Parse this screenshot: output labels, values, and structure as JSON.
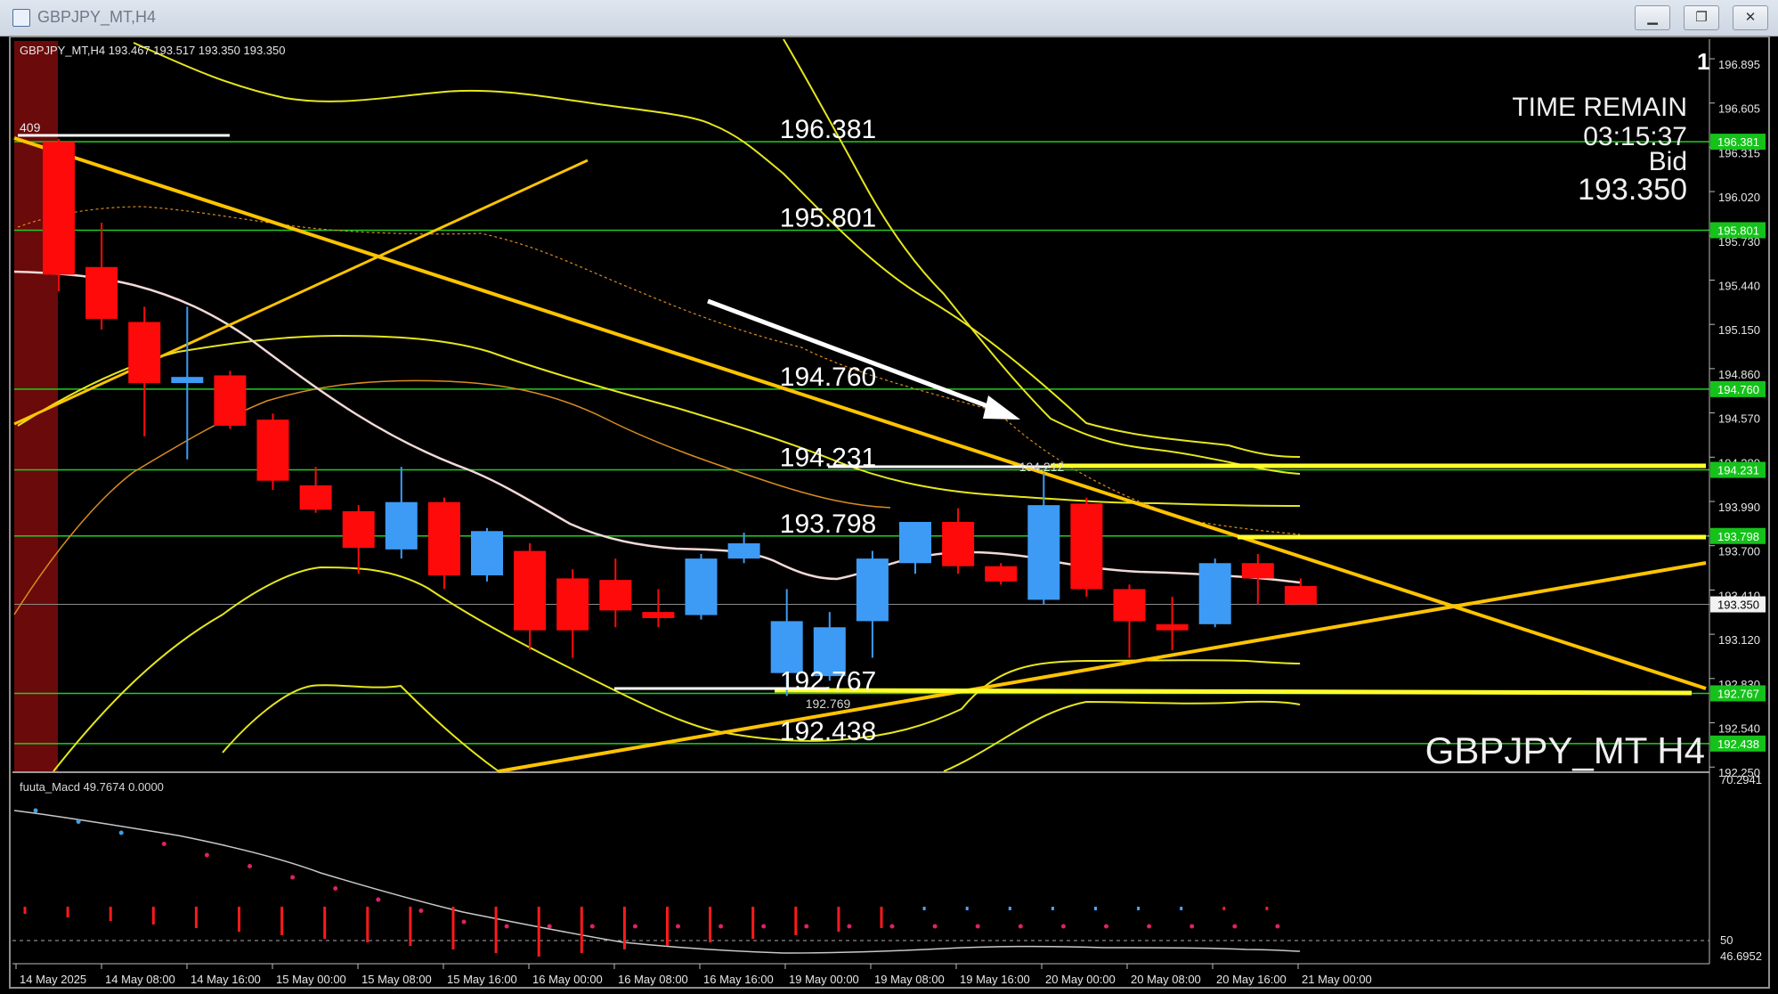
{
  "window": {
    "title": "GBPJPY_MT,H4",
    "minimize": "▁",
    "restore": "❐",
    "close": "✕"
  },
  "chart": {
    "header": "GBPJPY_MT,H4  193.467 193.517 193.350 193.350",
    "watermark": "GBPJPY_MT H4",
    "left_label": "409",
    "corner_mark": "1",
    "info": {
      "time_label": "TIME REMAIN",
      "time_value": "03:15:37",
      "bid_label": "Bid",
      "bid_value": "193.350"
    },
    "level_labels": [
      {
        "text": "196.381",
        "price": 196.381
      },
      {
        "text": "195.801",
        "price": 195.801
      },
      {
        "text": "194.760",
        "price": 194.76
      },
      {
        "text": "194.231",
        "price": 194.231
      },
      {
        "text": "193.798",
        "price": 193.798
      },
      {
        "text": "192.767",
        "price": 192.767
      },
      {
        "text": "192.438",
        "price": 192.438
      }
    ],
    "small_labels": [
      {
        "text": "194.212",
        "price": 194.212
      },
      {
        "text": "192.769",
        "price": 192.769
      }
    ],
    "colors": {
      "bull": "#3d9bf5",
      "bear": "#ff0a0a",
      "level": "#22cc22",
      "trend": "#ffc400",
      "band": "#e6e61e"
    }
  },
  "price_axis": {
    "ticks": [
      "196.895",
      "196.605",
      "196.315",
      "196.020",
      "195.730",
      "195.440",
      "195.150",
      "194.860",
      "194.570",
      "194.280",
      "193.990",
      "193.700",
      "193.410",
      "193.120",
      "192.830",
      "192.540",
      "192.250"
    ],
    "tags": [
      {
        "text": "196.381",
        "kind": "green"
      },
      {
        "text": "195.801",
        "kind": "green"
      },
      {
        "text": "194.760",
        "kind": "green"
      },
      {
        "text": "194.231",
        "kind": "green"
      },
      {
        "text": "193.798",
        "kind": "green"
      },
      {
        "text": "193.350",
        "kind": "white"
      },
      {
        "text": "192.767",
        "kind": "green"
      },
      {
        "text": "192.438",
        "kind": "green"
      }
    ]
  },
  "indicator": {
    "header": "fuuta_Macd 49.7674 0.0000",
    "ticks": [
      "70.2941",
      "50",
      "46.6952"
    ]
  },
  "time_axis": [
    "14 May 2025",
    "14 May 08:00",
    "14 May 16:00",
    "15 May 00:00",
    "15 May 08:00",
    "15 May 16:00",
    "16 May 00:00",
    "16 May 08:00",
    "16 May 16:00",
    "19 May 00:00",
    "19 May 08:00",
    "19 May 16:00",
    "20 May 00:00",
    "20 May 08:00",
    "20 May 16:00",
    "21 May 00:00"
  ],
  "chart_data": {
    "type": "candlestick",
    "symbol": "GBPJPY_MT",
    "timeframe": "H4",
    "candles": [
      {
        "o": 196.38,
        "h": 196.4,
        "c": 195.51,
        "l": 195.4
      },
      {
        "o": 195.56,
        "h": 195.85,
        "c": 195.22,
        "l": 195.15
      },
      {
        "o": 195.2,
        "h": 195.3,
        "c": 194.8,
        "l": 194.45
      },
      {
        "o": 194.8,
        "h": 195.3,
        "c": 194.84,
        "l": 194.3
      },
      {
        "o": 194.85,
        "h": 194.88,
        "c": 194.52,
        "l": 194.5
      },
      {
        "o": 194.56,
        "h": 194.6,
        "c": 194.16,
        "l": 194.1
      },
      {
        "o": 194.13,
        "h": 194.25,
        "c": 193.97,
        "l": 193.95
      },
      {
        "o": 193.96,
        "h": 194.0,
        "c": 193.72,
        "l": 193.55
      },
      {
        "o": 193.71,
        "h": 194.25,
        "c": 194.02,
        "l": 193.65
      },
      {
        "o": 194.02,
        "h": 194.05,
        "c": 193.54,
        "l": 193.45
      },
      {
        "o": 193.54,
        "h": 193.85,
        "c": 193.83,
        "l": 193.5
      },
      {
        "o": 193.7,
        "h": 193.75,
        "c": 193.18,
        "l": 193.05
      },
      {
        "o": 193.52,
        "h": 193.58,
        "c": 193.18,
        "l": 193.0
      },
      {
        "o": 193.51,
        "h": 193.65,
        "c": 193.31,
        "l": 193.2
      },
      {
        "o": 193.3,
        "h": 193.45,
        "c": 193.26,
        "l": 193.2
      },
      {
        "o": 193.28,
        "h": 193.68,
        "c": 193.65,
        "l": 193.25
      },
      {
        "o": 193.65,
        "h": 193.82,
        "c": 193.75,
        "l": 193.62
      },
      {
        "o": 192.9,
        "h": 193.45,
        "c": 193.24,
        "l": 192.75
      },
      {
        "o": 192.88,
        "h": 193.3,
        "c": 193.2,
        "l": 192.85
      },
      {
        "o": 193.24,
        "h": 193.7,
        "c": 193.65,
        "l": 193.0
      },
      {
        "o": 193.62,
        "h": 193.88,
        "c": 193.89,
        "l": 193.55
      },
      {
        "o": 193.89,
        "h": 193.98,
        "c": 193.6,
        "l": 193.55
      },
      {
        "o": 193.6,
        "h": 193.62,
        "c": 193.5,
        "l": 193.48
      },
      {
        "o": 193.38,
        "h": 194.21,
        "c": 194.0,
        "l": 193.35
      },
      {
        "o": 194.01,
        "h": 194.05,
        "c": 193.45,
        "l": 193.4
      },
      {
        "o": 193.45,
        "h": 193.48,
        "c": 193.24,
        "l": 193.0
      },
      {
        "o": 193.22,
        "h": 193.4,
        "c": 193.18,
        "l": 193.05
      },
      {
        "o": 193.22,
        "h": 193.65,
        "c": 193.62,
        "l": 193.2
      },
      {
        "o": 193.62,
        "h": 193.68,
        "c": 193.52,
        "l": 193.35
      },
      {
        "o": 193.47,
        "h": 193.52,
        "c": 193.35,
        "l": 193.35
      }
    ],
    "horizontal_levels": [
      196.381,
      195.801,
      194.76,
      194.231,
      193.798,
      192.767,
      192.438
    ],
    "bid": 193.35,
    "y_range": [
      192.22,
      197.0
    ]
  }
}
